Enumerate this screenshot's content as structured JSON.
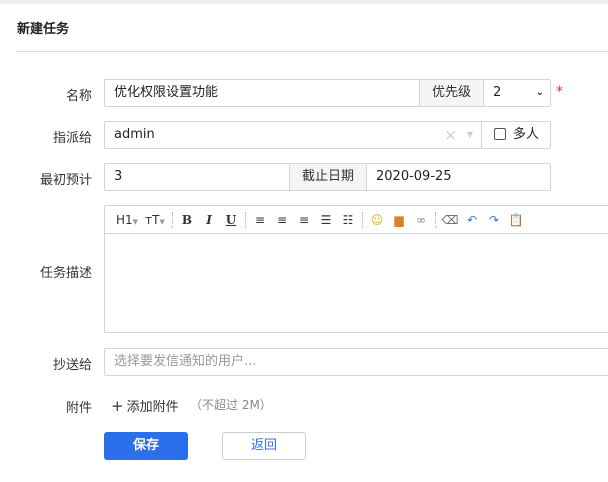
{
  "page": {
    "title": "新建任务"
  },
  "form": {
    "name": {
      "label": "名称",
      "value": "优化权限设置功能",
      "priority_label": "优先级",
      "priority_value": "2"
    },
    "assign": {
      "label": "指派给",
      "value": "admin",
      "multi_label": "多人"
    },
    "estimate": {
      "label": "最初预计",
      "value": "3",
      "deadline_label": "截止日期",
      "deadline_value": "2020-09-25"
    },
    "desc": {
      "label": "任务描述",
      "toolbar": {
        "h1": "H1",
        "font_size": "тT",
        "bold": "B",
        "italic": "I",
        "underline": "U"
      }
    },
    "cc": {
      "label": "抄送给",
      "placeholder": "选择要发信通知的用户..."
    },
    "attach": {
      "label": "附件",
      "add": "添加附件",
      "hint": "（不超过 2M）"
    }
  },
  "buttons": {
    "save": "保存",
    "back": "返回"
  },
  "colors": {
    "primary": "#2c6fea",
    "required": "#e53333"
  }
}
